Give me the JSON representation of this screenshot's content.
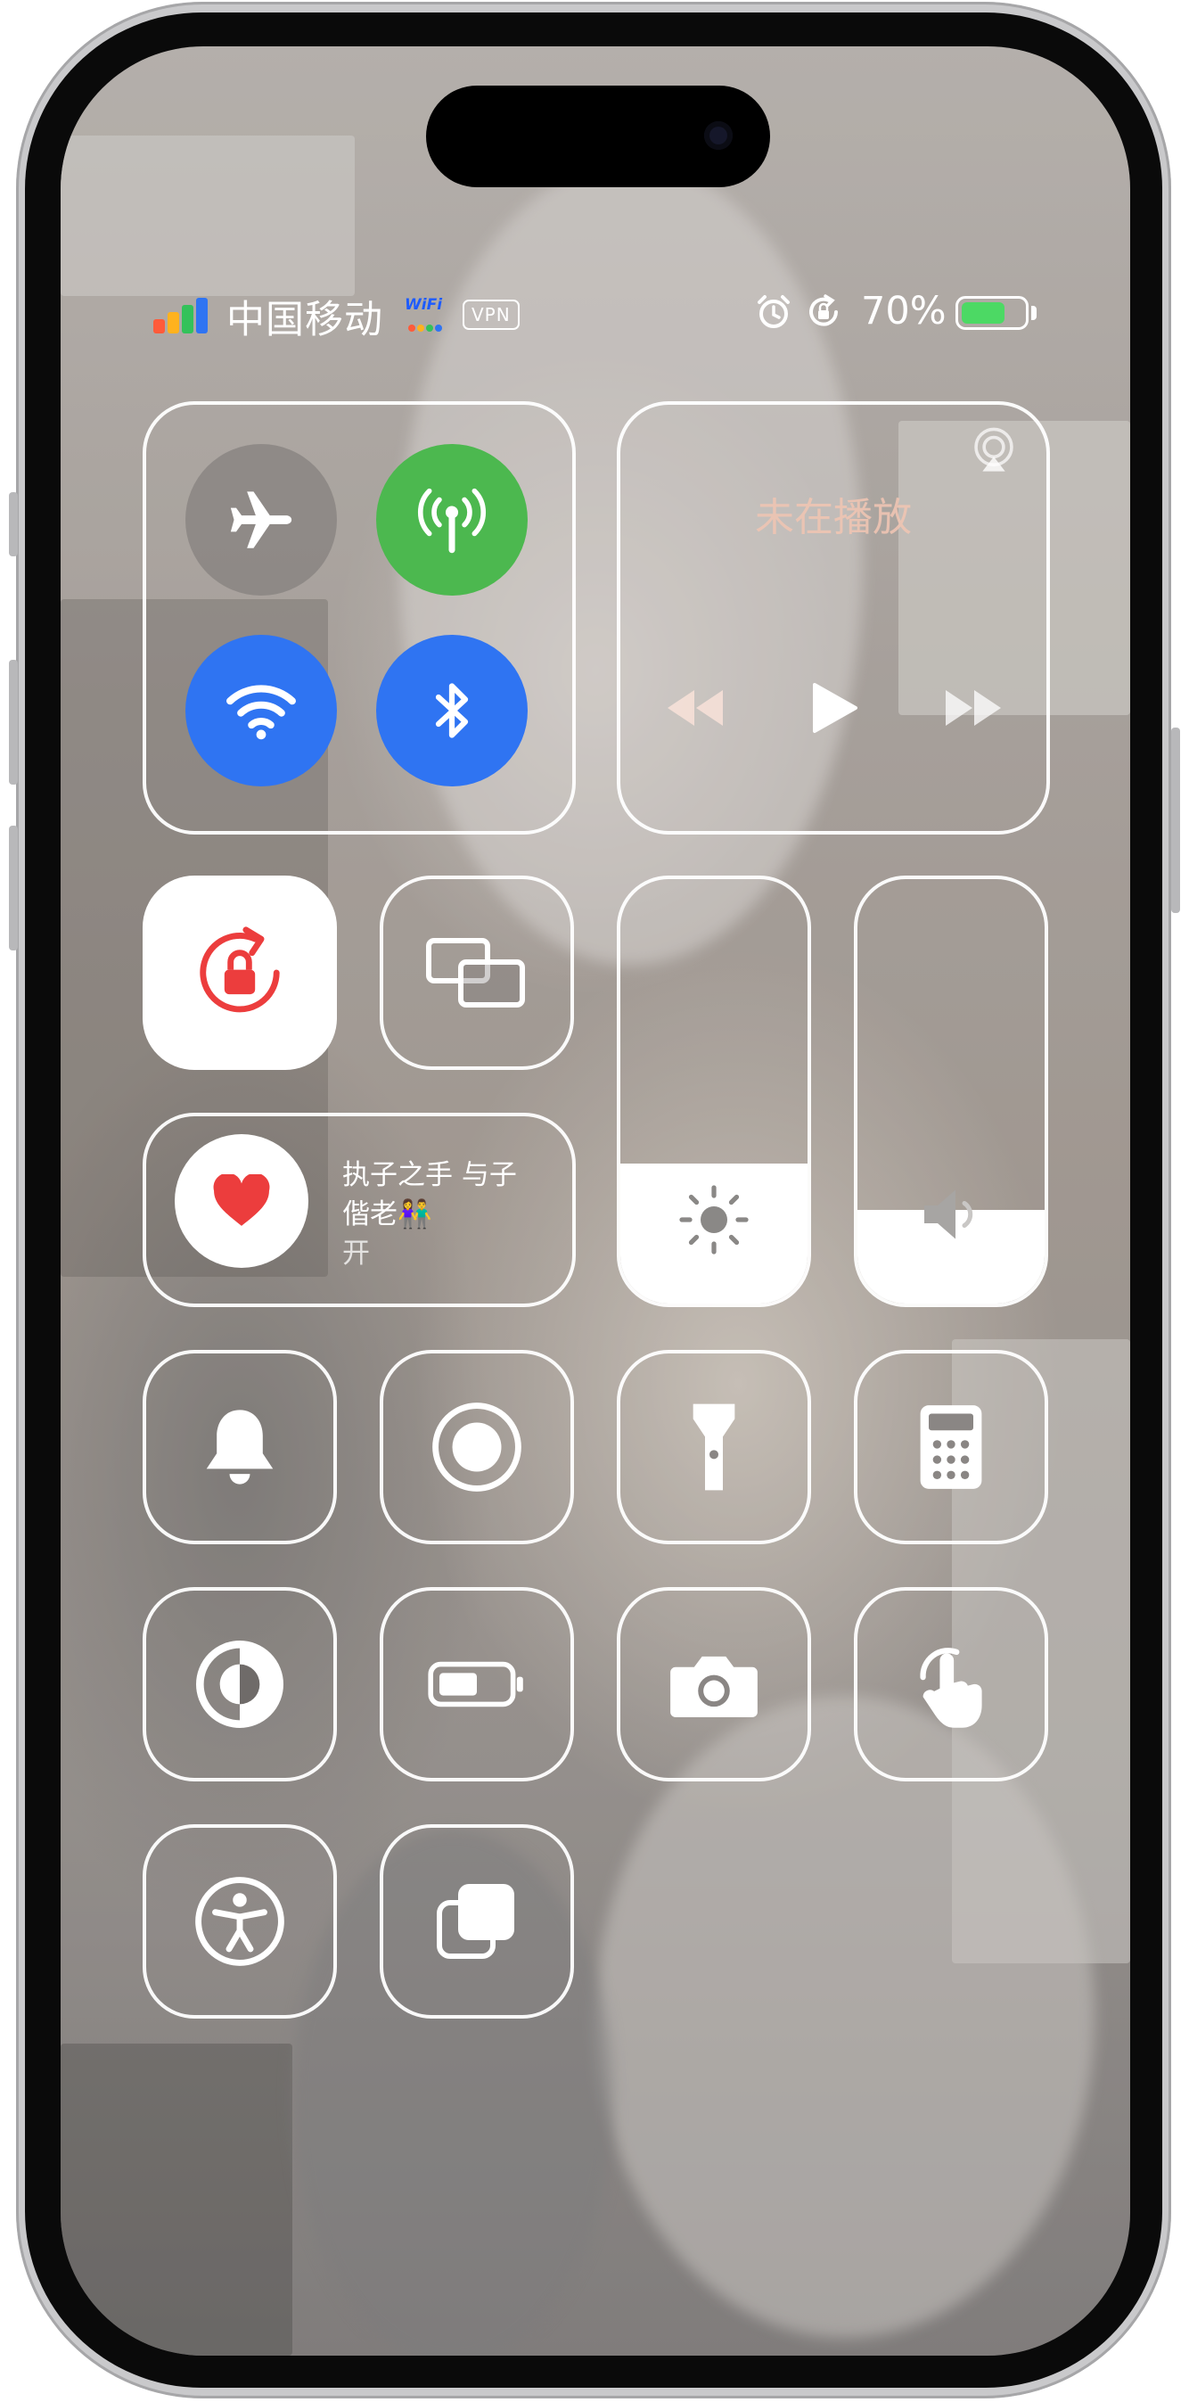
{
  "status_bar": {
    "carrier": "中国移动",
    "wifi_badge": "WiFi",
    "vpn": "VPN",
    "battery_percent": "70%",
    "battery_level": 0.7,
    "icons": [
      "signal-icon",
      "wifi-calling-icon",
      "alarm-icon",
      "orientation-lock-icon",
      "battery-icon"
    ]
  },
  "connectivity": {
    "airplane": {
      "icon": "airplane-icon",
      "on": false
    },
    "cellular": {
      "icon": "cellular-antenna-icon",
      "on": true,
      "color": "#4cb84f"
    },
    "wifi": {
      "icon": "wifi-icon",
      "on": true,
      "color": "#2f74f2"
    },
    "bluetooth": {
      "icon": "bluetooth-icon",
      "on": true,
      "color": "#2f74f2"
    }
  },
  "now_playing": {
    "title": "未在播放",
    "airplay_icon": "airplay-icon",
    "controls": [
      "rewind-icon",
      "play-icon",
      "fast-forward-icon"
    ]
  },
  "orientation_lock": {
    "icon": "orientation-lock-icon",
    "on": true,
    "color": "#ec3d3d"
  },
  "screen_mirroring": {
    "icon": "screen-mirroring-icon"
  },
  "focus": {
    "icon": "heart-icon",
    "name": "执子之手 与子偕老👫",
    "state": "开",
    "color": "#ec3d3d"
  },
  "brightness": {
    "icon": "sun-icon",
    "level": 0.33
  },
  "volume": {
    "icon": "speaker-icon",
    "level": 0.22
  },
  "quick_tiles": [
    {
      "name": "silent-mode",
      "icon": "bell-icon"
    },
    {
      "name": "screen-recording",
      "icon": "record-icon"
    },
    {
      "name": "flashlight",
      "icon": "flashlight-icon"
    },
    {
      "name": "calculator",
      "icon": "calculator-icon"
    },
    {
      "name": "dark-mode",
      "icon": "dark-mode-icon"
    },
    {
      "name": "low-power-mode",
      "icon": "low-battery-icon"
    },
    {
      "name": "camera",
      "icon": "camera-icon"
    },
    {
      "name": "assistive-touch",
      "icon": "hand-pointer-icon"
    },
    {
      "name": "accessibility",
      "icon": "accessibility-icon"
    },
    {
      "name": "stage-manager",
      "icon": "stage-manager-icon"
    }
  ]
}
